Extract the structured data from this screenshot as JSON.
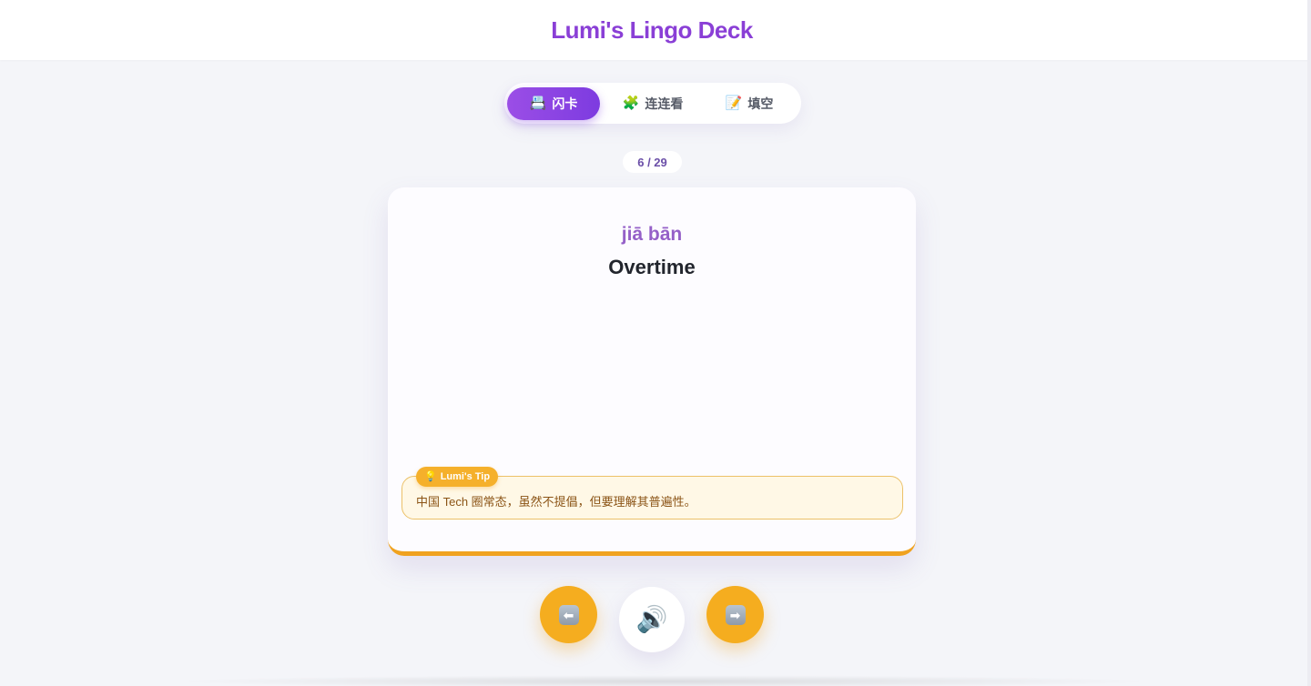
{
  "app": {
    "title": "Lumi's Lingo Deck"
  },
  "tabs": [
    {
      "icon": "📇",
      "icon_name": "card-index-icon",
      "label": "闪卡",
      "active": true
    },
    {
      "icon": "🧩",
      "icon_name": "puzzle-icon",
      "label": "连连看",
      "active": false
    },
    {
      "icon": "📝",
      "icon_name": "memo-icon",
      "label": "填空",
      "active": false
    }
  ],
  "progress": {
    "label": "6 / 29",
    "current": 6,
    "total": 29
  },
  "card": {
    "pinyin": "jiā bān",
    "meaning": "Overtime",
    "tip": {
      "badge_icon": "💡",
      "badge_label": "Lumi's Tip",
      "text": "中国 Tech 圈常态，虽然不提倡，但要理解其普遍性。"
    }
  },
  "controls": {
    "prev": {
      "icon": "⬅",
      "icon_name": "left-arrow-icon"
    },
    "audio": {
      "icon": "🔊",
      "icon_name": "speaker-icon"
    },
    "next": {
      "icon": "➡",
      "icon_name": "right-arrow-icon"
    }
  },
  "colors": {
    "brand": "#8a3fd6",
    "accent": "#f5ad1f",
    "tip_background": "#fff8e6",
    "tip_text": "#8b5416"
  }
}
